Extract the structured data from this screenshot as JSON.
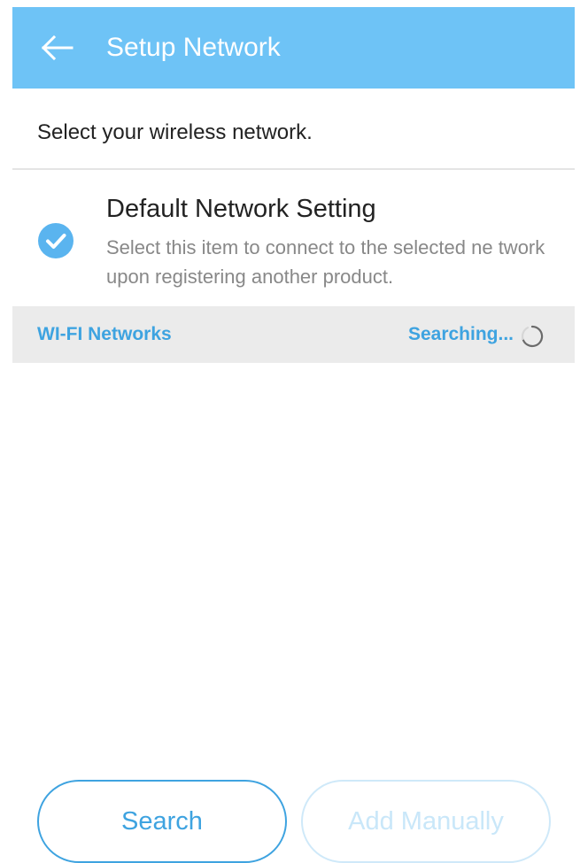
{
  "header": {
    "title": "Setup Network",
    "background_color": "#6ec3f6",
    "back_icon": "arrow-left-icon"
  },
  "subtitle": "Select your wireless network.",
  "default_setting": {
    "title": "Default Network Setting",
    "description": "Select this item to connect to the selected ne twork upon registering another product.",
    "checked": true,
    "check_icon": "check-circle-icon",
    "check_color": "#5ab4ef"
  },
  "wifi_section": {
    "label": "WI-FI Networks",
    "status": "Searching...",
    "status_icon": "spinner-icon",
    "accent_color": "#3ea3e0"
  },
  "buttons": {
    "search_label": "Search",
    "add_manually_label": "Add Manually",
    "add_manually_enabled": false
  }
}
